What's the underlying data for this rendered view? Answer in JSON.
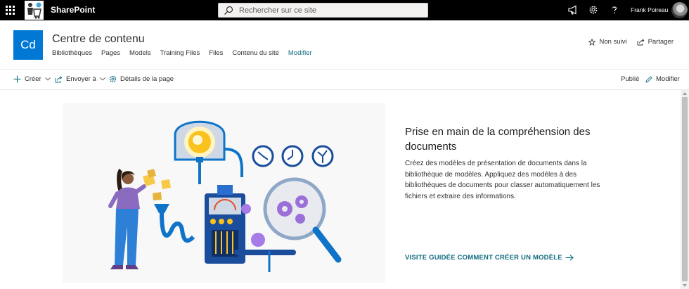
{
  "suite_bar": {
    "app_name": "SharePoint",
    "search_placeholder": "Rechercher sur ce site",
    "user_name": "Frank Poireau",
    "icons": [
      "waffle-icon",
      "megaphone-icon",
      "gear-icon",
      "help-icon"
    ]
  },
  "site": {
    "logo_text": "Cd",
    "title": "Centre de contenu",
    "nav": [
      "Bibliothèques",
      "Pages",
      "Models",
      "Training Files",
      "Files",
      "Contenu du site",
      "Modifier"
    ],
    "follow_label": "Non suivi",
    "share_label": "Partager"
  },
  "command_bar": {
    "create": "Créer",
    "send_to": "Envoyer à",
    "page_details": "Détails de la page",
    "published": "Publié",
    "edit": "Modifier"
  },
  "main": {
    "title": "Prise en main de la compréhension des documents",
    "body": "Créez des modèles de présentation de documents dans la bibliothèque de modèles. Appliquez des modèles à des bibliothèques de documents pour classer automatiquement les fichiers et extraire des informations.",
    "link": "VISITE GUIDÉE COMMENT CRÉER UN MODÈLE"
  },
  "colors": {
    "suite_bar": "#000000",
    "site_logo": "#0078d4",
    "accent_link": "#0f6b80"
  }
}
